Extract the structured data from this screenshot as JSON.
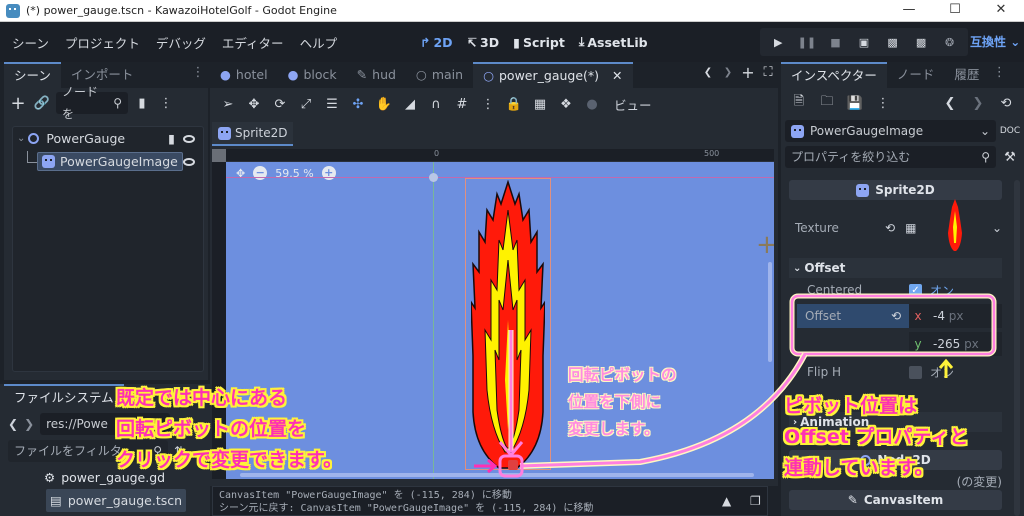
{
  "window": {
    "title": "(*) power_gauge.tscn - KawazoiHotelGolf - Godot Engine",
    "controls": [
      "minimize",
      "maximize",
      "close"
    ]
  },
  "menubar": {
    "menus": [
      "シーン",
      "プロジェクト",
      "デバッグ",
      "エディター",
      "ヘルプ"
    ],
    "workspaces": [
      {
        "label": "2D",
        "icon": "2d-icon",
        "active": true
      },
      {
        "label": "3D",
        "icon": "3d-icon",
        "active": false
      },
      {
        "label": "Script",
        "icon": "script-icon",
        "active": false
      },
      {
        "label": "AssetLib",
        "icon": "download-icon",
        "active": false
      }
    ],
    "run_buttons": [
      "play-icon",
      "pause-icon",
      "stop-icon",
      "remote-debug-icon",
      "play-scene-icon",
      "play-custom-scene-icon",
      "movie-maker-icon"
    ],
    "renderer": "互換性"
  },
  "scene_dock": {
    "tabs": [
      "シーン",
      "インポート"
    ],
    "filter_placeholder": "ノードを",
    "tree": [
      {
        "name": "PowerGauge",
        "type": "Node2D",
        "has_script": true,
        "visible": true
      },
      {
        "name": "PowerGaugeImage",
        "type": "Sprite2D",
        "selected": true,
        "visible": true
      }
    ]
  },
  "filesystem_dock": {
    "title": "ファイルシステム",
    "path": "res://Powe",
    "filter_placeholder": "ファイルをフィルタ",
    "files": [
      {
        "name": "power_gauge.gd",
        "icon": "gear-icon"
      },
      {
        "name": "power_gauge.tscn",
        "icon": "scene-icon",
        "selected": true
      }
    ]
  },
  "editor": {
    "scene_tabs": [
      {
        "label": "hotel",
        "icon": "globe-icon"
      },
      {
        "label": "block",
        "icon": "globe-icon"
      },
      {
        "label": "hud",
        "icon": "control-icon"
      },
      {
        "label": "main",
        "icon": "node-icon"
      },
      {
        "label": "power_gauge(*)",
        "icon": "node-icon",
        "active": true
      }
    ],
    "view_menu": "ビュー",
    "breadcrumb": "Sprite2D",
    "zoom_level": "59.5 %",
    "ruler_labels": [
      "0",
      "500"
    ],
    "console_lines": [
      "CanvasItem \"PowerGaugeImage\" を (-115, 284) に移動",
      "シーン元に戻す: CanvasItem \"PowerGaugeImage\" を (-115, 284) に移動"
    ]
  },
  "inspector": {
    "tabs": [
      "インスペクター",
      "ノード",
      "履歴"
    ],
    "object_name": "PowerGaugeImage",
    "filter_placeholder": "プロパティを絞り込む",
    "class_header": "Sprite2D",
    "texture_label": "Texture",
    "offset_group": "Offset",
    "centered": {
      "label": "Centered",
      "value": "オン",
      "checked": true
    },
    "offset": {
      "label": "Offset",
      "x": "-4",
      "y": "-265",
      "unit": "px"
    },
    "flip_h": {
      "label": "Flip H",
      "value": "オン",
      "checked": false
    },
    "animation_group": "Animation",
    "node2d_header": "Node2D",
    "transform_hint": "(の変更)",
    "canvasitem_header": "CanvasItem"
  },
  "annotations": {
    "left": [
      "既定では中心にある",
      "回転ピボットの位置を",
      "クリックで変更できます。"
    ],
    "middle": [
      "回転ピボットの",
      "位置を下側に",
      "変更します。"
    ],
    "right": [
      "ピボット位置は",
      "Offset プロパティと",
      "連動しています。"
    ]
  },
  "colors": {
    "accent": "#6ea3f5",
    "canvas_bg": "#6d8fdf",
    "annotation_magenta": "#ff2fb3",
    "annotation_yellow": "#fff23a",
    "annotation_pink": "#ff8be0",
    "flame_red": "#ff1a0a",
    "flame_yellow": "#fff200"
  }
}
